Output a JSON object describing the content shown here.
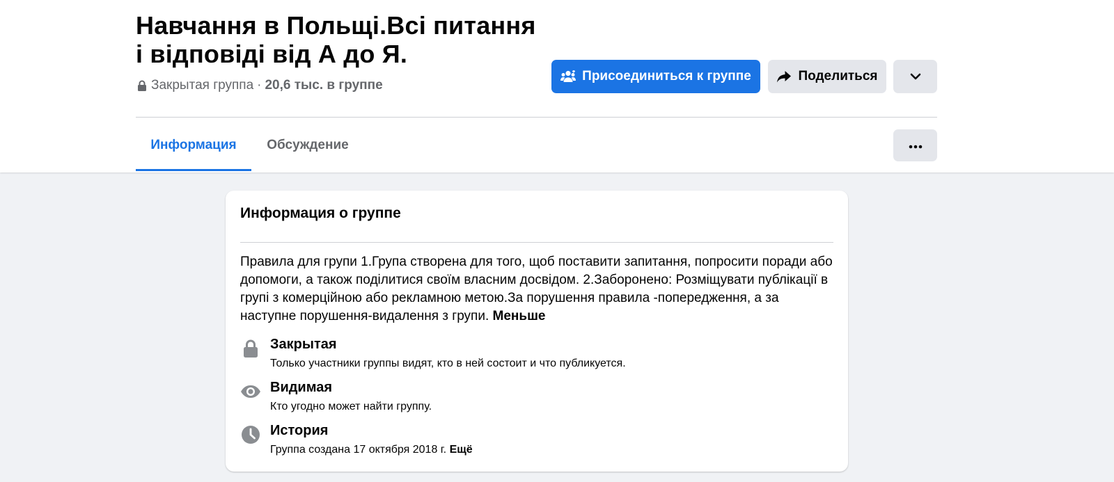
{
  "header": {
    "title_line1": "Навчання в Польщі.Всі питання",
    "title_line2": "і відповіді від А до Я.",
    "privacy": "Закрытая группа",
    "separator": "·",
    "members": "20,6 тыс. в группе"
  },
  "actions": {
    "join_label": "Присоединиться к группе",
    "share_label": "Поделиться"
  },
  "tabs": [
    {
      "label": "Информация",
      "active": true
    },
    {
      "label": "Обсуждение",
      "active": false
    }
  ],
  "about": {
    "title": "Информация о группе",
    "description": "Правила для групи 1.Група створена для того, щоб поставити запитання, попросити поради або допомоги, а також поділитися своїм власним досвідом. 2.Заборонено: Розміщувати публікації в групі з комерційною або рекламною метою.За порушення правила -попередження, а за наступне порушення-видалення з групи.",
    "less_label": "Меньше",
    "items": [
      {
        "icon": "lock-icon",
        "title": "Закрытая",
        "text": "Только участники группы видят, кто в ней состоит и что публикуется."
      },
      {
        "icon": "eye-icon",
        "title": "Видимая",
        "text": "Кто угодно может найти группу."
      },
      {
        "icon": "clock-icon",
        "title": "История",
        "text": "Группа создана 17 октября 2018 г.",
        "more_label": "Ещё"
      }
    ]
  },
  "colors": {
    "accent": "#1B74E4",
    "secondary_button": "#E4E6EB",
    "page_background": "#F0F2F5",
    "muted_text": "#65676B",
    "icon_gray": "#8A8D91"
  }
}
